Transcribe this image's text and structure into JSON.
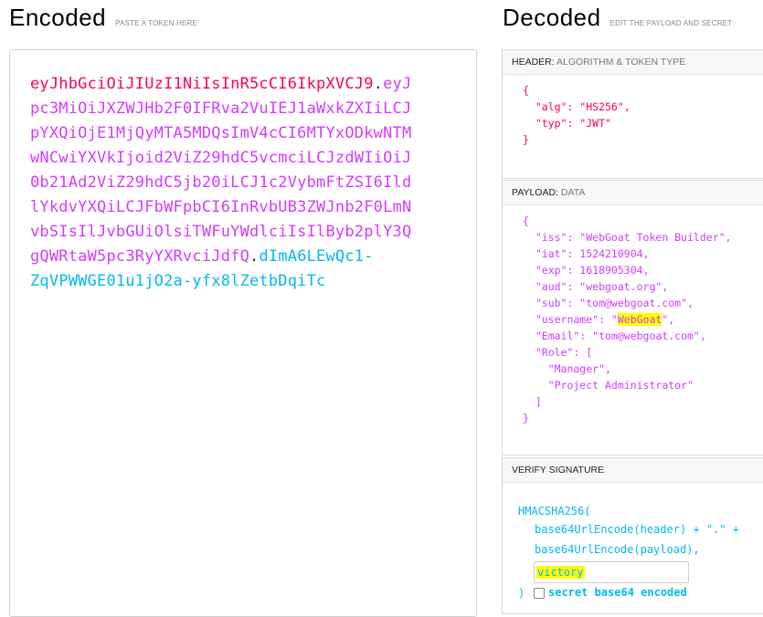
{
  "encoded": {
    "title": "Encoded",
    "hint": "PASTE A TOKEN HERE",
    "token_lines": [
      [
        {
          "c": "tok-header",
          "t": "eyJhbGciOiJIUzI1NiIsInR5cCI6IkpXVCJ9"
        },
        {
          "c": "tok-dot",
          "t": "."
        },
        {
          "c": "tok-payload",
          "t": "eyJ"
        }
      ],
      [
        {
          "c": "tok-payload",
          "t": "pc3MiOiJXZWJHb2F0IFRva2VuIEJ1aWxkZXIiLCJ"
        }
      ],
      [
        {
          "c": "tok-payload",
          "t": "pYXQiOjE1MjQyMTA5MDQsImV4cCI6MTYxODkwNTM"
        }
      ],
      [
        {
          "c": "tok-payload",
          "t": "wNCwiYXVkIjoid2ViZ29hdC5vcmciLCJzdWIiOiJ"
        }
      ],
      [
        {
          "c": "tok-payload",
          "t": "0b21Ad2ViZ29hdC5jb20iLCJ1c2VybmFtZSI6Ild"
        }
      ],
      [
        {
          "c": "tok-payload",
          "t": "lYkdvYXQiLCJFbWFpbCI6InRvbUB3ZWJnb2F0LmN"
        }
      ],
      [
        {
          "c": "tok-payload",
          "t": "vbSIsIlJvbGUiOlsiTWFuYWdlciIsIlByb2plY3Q"
        }
      ],
      [
        {
          "c": "tok-payload",
          "t": "gQWRtaW5pc3RyYXRvciJdfQ"
        },
        {
          "c": "tok-dot",
          "t": "."
        },
        {
          "c": "tok-sig",
          "t": "dImA6LEwQc1-"
        }
      ],
      [
        {
          "c": "tok-sig",
          "t": "ZqVPWWGE01u1jO2a-yfx8lZetbDqiTc"
        }
      ]
    ]
  },
  "decoded": {
    "title": "Decoded",
    "hint": "EDIT THE PAYLOAD AND SECRET"
  },
  "header_panel": {
    "label": "HEADER:",
    "sublabel": "ALGORITHM & TOKEN TYPE",
    "lines": [
      "{",
      "  \"alg\": \"HS256\",",
      "  \"typ\": \"JWT\"",
      "}"
    ]
  },
  "payload_panel": {
    "label": "PAYLOAD:",
    "sublabel": "DATA",
    "lines_before": [
      "{",
      "  \"iss\": \"WebGoat Token Builder\",",
      "  \"iat\": 1524210904,",
      "  \"exp\": 1618905304,",
      "  \"aud\": \"webgoat.org\",",
      "  \"sub\": \"tom@webgoat.com\","
    ],
    "username_prefix": "  \"username\": \"",
    "username_value": "WebGoat",
    "username_suffix": "\",",
    "lines_after": [
      "  \"Email\": \"tom@webgoat.com\",",
      "  \"Role\": [",
      "    \"Manager\",",
      "    \"Project Administrator\"",
      "  ]",
      "}"
    ]
  },
  "verify_panel": {
    "label": "VERIFY SIGNATURE",
    "line1": "HMACSHA256(",
    "line2": "base64UrlEncode(header) + \".\" +",
    "line3": "base64UrlEncode(payload),",
    "secret_value": "victory",
    "line4": ")",
    "checkbox_label": "secret base64 encoded"
  },
  "colors": {
    "header": "#fb015b",
    "payload": "#d63aff",
    "signature": "#00b9f1",
    "highlight": "#ffff00"
  }
}
